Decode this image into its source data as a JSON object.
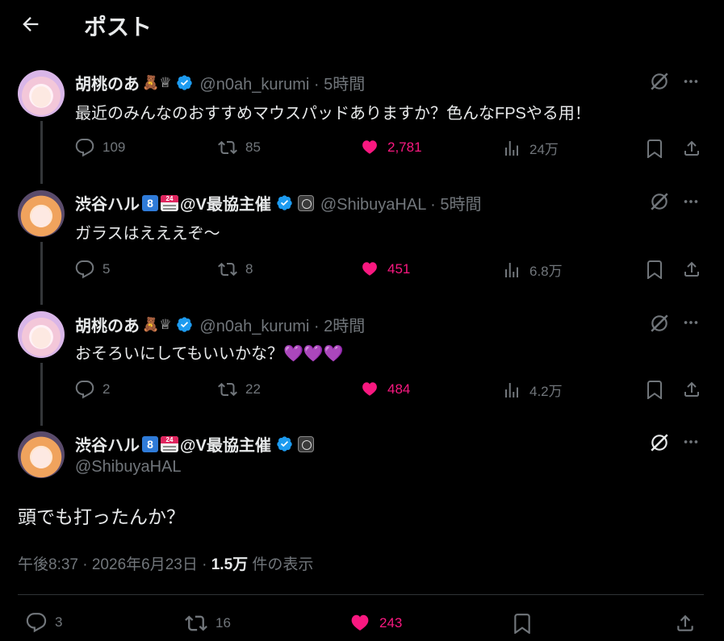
{
  "header": {
    "title": "ポスト"
  },
  "posts": [
    {
      "name": "胡桃のあ",
      "emojis": "🧸♕",
      "handle": "@n0ah_kurumi · 5時間",
      "text": "最近のみんなのおすすめマウスパッドありますか？色んなFPSやる用！",
      "replies": "109",
      "reposts": "85",
      "likes": "2,781",
      "views": "24万"
    },
    {
      "name": "渋谷ハル",
      "badge_number": "8",
      "badge_24": "24",
      "name_suffix": "@V最協主催",
      "handle": "@ShibuyaHAL · 5時間",
      "text": "ガラスはえええぞ〜",
      "replies": "5",
      "reposts": "8",
      "likes": "451",
      "views": "6.8万"
    },
    {
      "name": "胡桃のあ",
      "emojis": "🧸♕",
      "handle": "@n0ah_kurumi · 2時間",
      "text": "おそろいにしてもいいかな？💜💜💜",
      "replies": "2",
      "reposts": "22",
      "likes": "484",
      "views": "4.2万"
    }
  ],
  "main_post": {
    "name": "渋谷ハル",
    "badge_number": "8",
    "badge_24": "24",
    "name_suffix": "@V最協主催",
    "handle": "@ShibuyaHAL",
    "text": "頭でも打ったんか？",
    "timestamp": "午後8:37 · 2026年6月23日 · ",
    "views_count": "1.5万",
    "views_label": " 件の表示",
    "replies": "3",
    "reposts": "16",
    "likes": "243"
  },
  "colors": {
    "background": "#000000",
    "text": "#e7e9ea",
    "muted": "#71767b",
    "like": "#f91880",
    "verified": "#1d9bf0"
  }
}
